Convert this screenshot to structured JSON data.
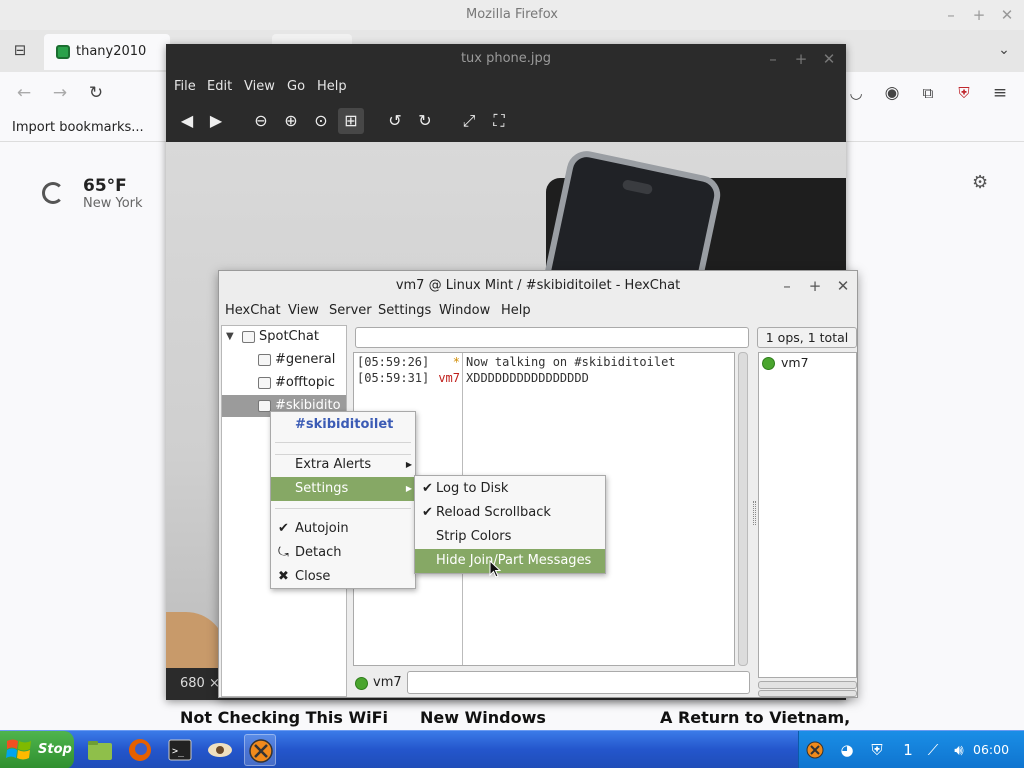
{
  "firefox": {
    "window_title": "Mozilla Firefox",
    "tab_label": "thany2010",
    "bookmark_import": "Import bookmarks...",
    "weather": {
      "temp": "65°F",
      "city": "New York"
    },
    "headlines": [
      "Not Checking This WiFi",
      "New Windows",
      "A Return to Vietnam,"
    ]
  },
  "viewer": {
    "title": "tux phone.jpg",
    "menus": [
      "File",
      "Edit",
      "View",
      "Go",
      "Help"
    ],
    "status": "680 ×"
  },
  "hexchat": {
    "title": "vm7 @ Linux Mint / #skibiditoilet - HexChat",
    "menus": [
      "HexChat",
      "View",
      "Server",
      "Settings",
      "Window",
      "Help"
    ],
    "tree": {
      "network": "SpotChat",
      "channels": [
        "#general",
        "#offtopic",
        "#skibidito"
      ]
    },
    "user_count": "1 ops, 1 total",
    "messages": [
      {
        "time": "[05:59:26]",
        "nick": "*",
        "nick_color": "#d08b00",
        "text": "Now talking on #skibiditoilet"
      },
      {
        "time": "[05:59:31]",
        "nick": "vm7",
        "nick_color": "#c0201c",
        "text": "XDDDDDDDDDDDDDDDD"
      }
    ],
    "users": [
      "vm7"
    ],
    "nick": "vm7"
  },
  "context_menu": {
    "header": "#skibiditoilet",
    "extra_alerts": "Extra Alerts",
    "settings": "Settings",
    "autojoin": "Autojoin",
    "detach": "Detach",
    "close": "Close"
  },
  "settings_submenu": {
    "log_to_disk": "Log to Disk",
    "reload_scrollback": "Reload Scrollback",
    "strip_colors": "Strip Colors",
    "hide_join_part": "Hide Join/Part Messages"
  },
  "taskbar": {
    "start_label": "Stop",
    "clock": "06:00",
    "tray_badge": "1"
  },
  "colors": {
    "menu_highlight": "#86a865",
    "taskbar": "#2456cc",
    "context_header": "#3b5bb5"
  }
}
